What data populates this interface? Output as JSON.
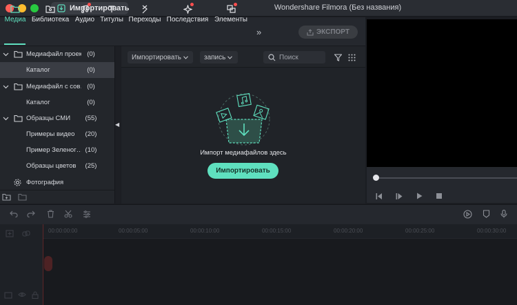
{
  "window": {
    "title": "Wondershare Filmora (Без названия)",
    "import_button": "Импортировать"
  },
  "toolbar": {
    "tabs": [
      {
        "label": "Медиа",
        "icon": "folder-icon",
        "active": true,
        "badge": false
      },
      {
        "label": "Библиотека",
        "icon": "image-library-icon",
        "active": false,
        "badge": false
      },
      {
        "label": "Аудио",
        "icon": "music-note-icon",
        "active": false,
        "badge": true
      },
      {
        "label": "Титулы",
        "icon": "text-title-icon",
        "active": false,
        "badge": false
      },
      {
        "label": "Переходы",
        "icon": "transition-icon",
        "active": false,
        "badge": false
      },
      {
        "label": "Последствия",
        "icon": "effects-icon",
        "active": false,
        "badge": true
      },
      {
        "label": "Элементы",
        "icon": "elements-icon",
        "active": false,
        "badge": true
      }
    ],
    "more": "»",
    "export_label": "ЭКСПОРТ"
  },
  "library": {
    "items": [
      {
        "name": "Медиафайл проек…",
        "count": "(0)",
        "level": 0,
        "expanded": true,
        "selected": false,
        "icon": "folder-icon"
      },
      {
        "name": "Каталог",
        "count": "(0)",
        "level": 1,
        "selected": true
      },
      {
        "name": "Медиафайл с сов…",
        "count": "(0)",
        "level": 0,
        "expanded": true,
        "selected": false,
        "icon": "folder-icon"
      },
      {
        "name": "Каталог",
        "count": "(0)",
        "level": 1,
        "selected": false
      },
      {
        "name": "Образцы СМИ",
        "count": "(55)",
        "level": 0,
        "expanded": true,
        "selected": false,
        "icon": "folder-icon"
      },
      {
        "name": "Примеры видео",
        "count": "(20)",
        "level": 1,
        "selected": false
      },
      {
        "name": "Пример Зеленог…",
        "count": "(10)",
        "level": 1,
        "selected": false
      },
      {
        "name": "Образцы цветов",
        "count": "(25)",
        "level": 1,
        "selected": false
      },
      {
        "name": "Фотография",
        "count": "",
        "level": 0,
        "selected": false,
        "icon": "gear-icon"
      }
    ]
  },
  "media": {
    "import_dropdown": "Импортировать",
    "record_dropdown": "запись",
    "search_placeholder": "Поиск",
    "drop_text": "Импорт медиафайлов здесь",
    "import_button": "Импортировать"
  },
  "timeline": {
    "ticks": [
      "00:00:00:00",
      "00:00:05:00",
      "00:00:10:00",
      "00:00:15:00",
      "00:00:20:00",
      "00:00:25:00",
      "00:00:30:00"
    ]
  },
  "colors": {
    "accent": "#5fe0bf",
    "background": "#1b1d22",
    "badge": "#ff4e4e"
  }
}
